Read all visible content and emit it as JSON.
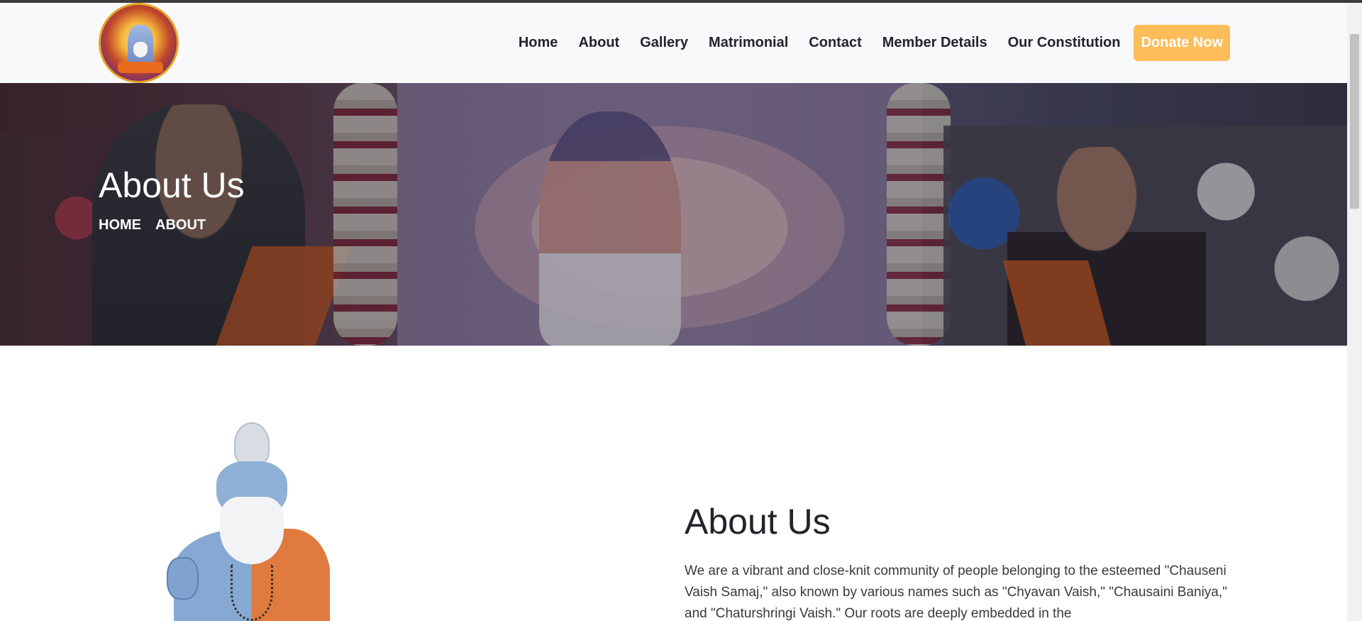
{
  "nav": {
    "links": [
      "Home",
      "About",
      "Gallery",
      "Matrimonial",
      "Contact",
      "Member Details",
      "Our Constitution"
    ],
    "donate_label": "Donate Now"
  },
  "colors": {
    "accent": "#ffbd59",
    "navbar_bg": "#f8f9fa"
  },
  "hero": {
    "title": "About Us",
    "breadcrumb": [
      "HOME",
      "ABOUT"
    ]
  },
  "about": {
    "heading": "About Us",
    "text": "We are a vibrant and close-knit community of people belonging to the esteemed \"Chauseni Vaish Samaj,\" also known by various names such as \"Chyavan Vaish,\" \"Chausaini Baniya,\" and \"Chaturshringi Vaish.\" Our roots are deeply embedded in the"
  },
  "icons": {
    "logo": "community-logo",
    "sage": "sage-illustration"
  }
}
